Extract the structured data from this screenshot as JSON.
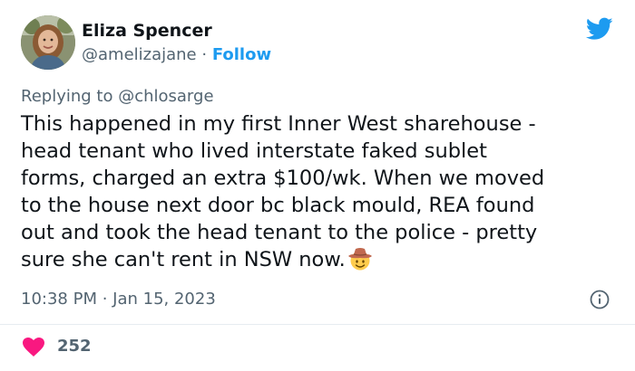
{
  "author": {
    "name": "Eliza Spencer",
    "handle": "@amelizajane",
    "separator": " · ",
    "follow_label": "Follow"
  },
  "reply": {
    "prefix": "Replying to ",
    "mention": "@chlosarge"
  },
  "tweet": {
    "text": "This happened in my first Inner West sharehouse -\nhead tenant who lived interstate faked sublet\nforms, charged an extra $100/wk. When we moved\nto the house next door bc black mould, REA found\nout and took the head tenant to the police - pretty\nsure she can't rent in NSW now.",
    "emoji": "cowboy-face"
  },
  "meta": {
    "time": "10:38 PM",
    "separator": " · ",
    "date": "Jan 15, 2023"
  },
  "engagement": {
    "likes": "252"
  },
  "icons": {
    "brand": "twitter-bird-icon",
    "info": "info-icon",
    "like": "heart-icon"
  },
  "colors": {
    "accent": "#1d9bf0",
    "secondary_text": "#536471",
    "heart": "#f91880"
  }
}
